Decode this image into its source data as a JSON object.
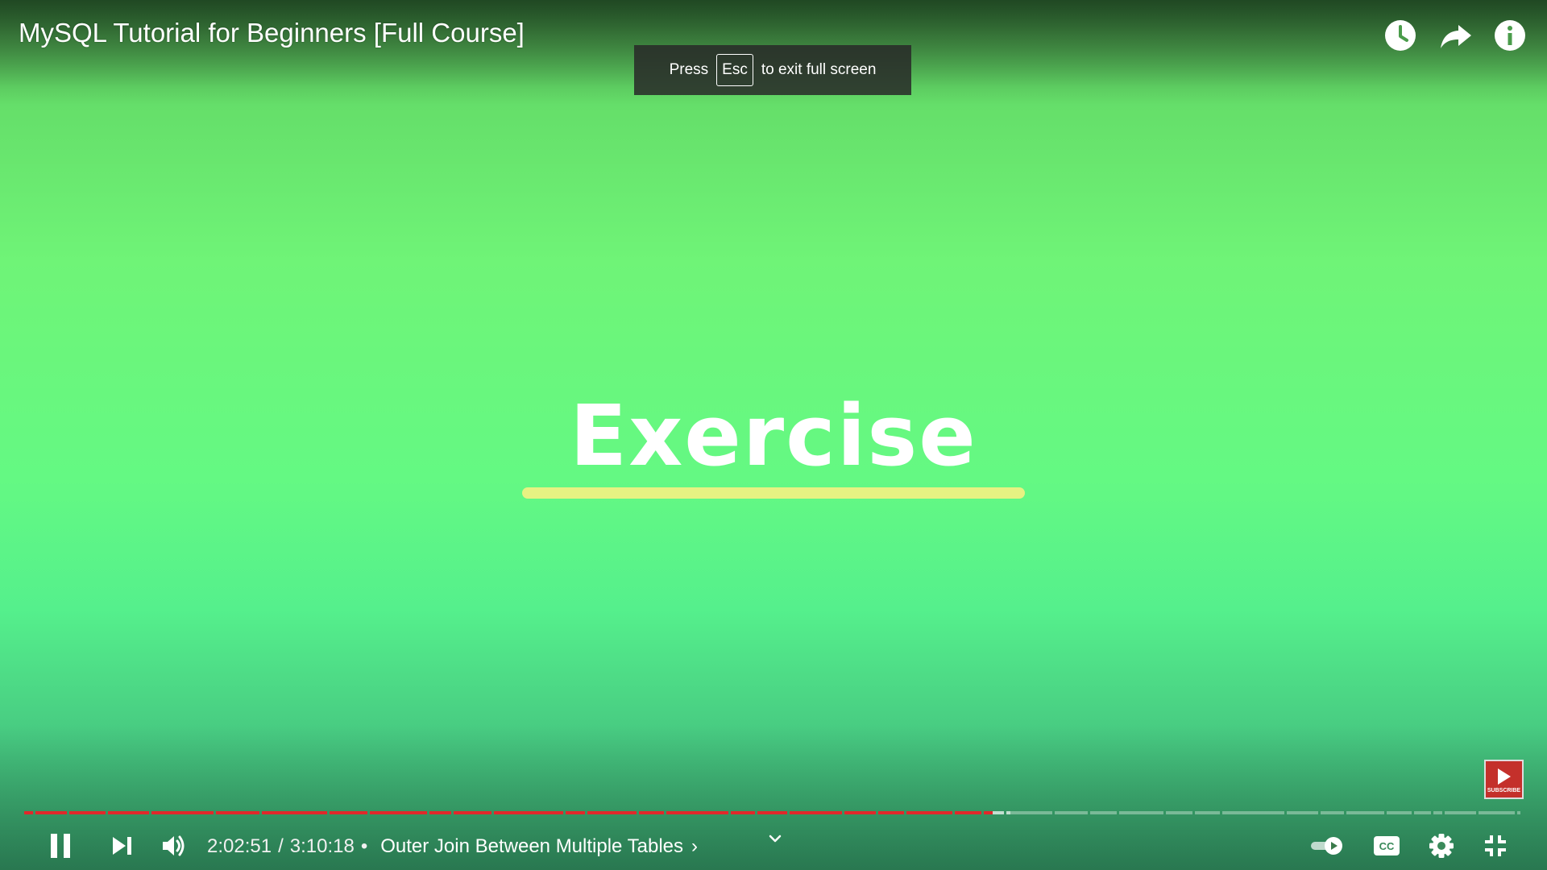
{
  "video": {
    "title": "MySQL Tutorial for Beginners [Full Course]"
  },
  "top_actions": [
    {
      "name": "watch-later-icon",
      "label": "Watch later"
    },
    {
      "name": "share-icon",
      "label": "Share"
    },
    {
      "name": "info-icon",
      "label": "Info"
    }
  ],
  "fullscreen_toast": {
    "prefix": "Press",
    "key": "Esc",
    "suffix": "to exit full screen"
  },
  "slide": {
    "heading": "Exercise",
    "underline_color": "#e6f282"
  },
  "subscribe_badge": {
    "text": "SUBSCRIBE",
    "color": "#c4302b"
  },
  "player": {
    "progress_fraction": 0.646,
    "buffered_fraction": 0.658,
    "progress_color": "#e0282a",
    "current_time": "2:02:51",
    "duration": "3:10:18",
    "time_separator": "/",
    "chapter_separator": "•",
    "chapter_title": "Outer Join Between Multiple Tables",
    "chapter_chevron": "›"
  },
  "controls": {
    "left": [
      "pause-icon",
      "next-icon",
      "volume-icon"
    ],
    "right": [
      "autoplay-toggle",
      "captions-icon",
      "settings-icon",
      "exit-fullscreen-icon"
    ]
  }
}
